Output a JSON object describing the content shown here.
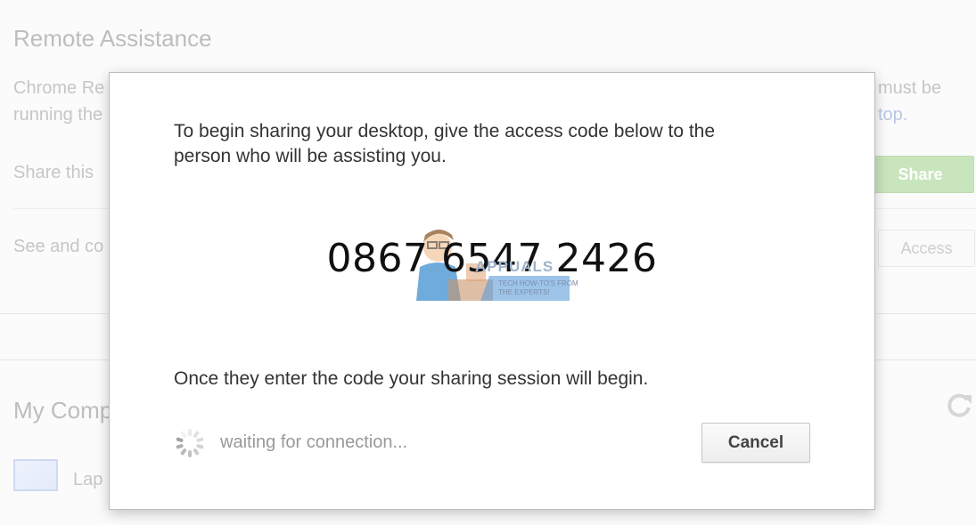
{
  "background": {
    "title": "Remote Assistance",
    "description_left": [
      "Chrome Re",
      "running the"
    ],
    "description_right": [
      "must be",
      "top."
    ],
    "share_row_label": "Share this",
    "share_button": "Share",
    "access_row_label": "See and co",
    "access_button": "Access",
    "my_computers_title": "My Comp",
    "computer_item_label": "Lap"
  },
  "dialog": {
    "intro_line1": "To begin sharing your desktop, give the access code below to the",
    "intro_line2": "person who will be assisting you.",
    "access_code": "0867 6547 2426",
    "note": "Once they enter the code your sharing session will begin.",
    "status": "waiting for connection...",
    "cancel_button": "Cancel"
  },
  "watermark": {
    "brand": "APPUALS",
    "tagline_line1": "TECH HOW-TO'S FROM",
    "tagline_line2": "THE EXPERTS!"
  },
  "icons": {
    "refresh": "refresh-icon",
    "laptop": "laptop-icon",
    "spinner": "loading-spinner-icon"
  },
  "colors": {
    "share_button": "#c9e5bd",
    "link": "#b7c8e3",
    "dialog_border": "#bdbdbd"
  }
}
